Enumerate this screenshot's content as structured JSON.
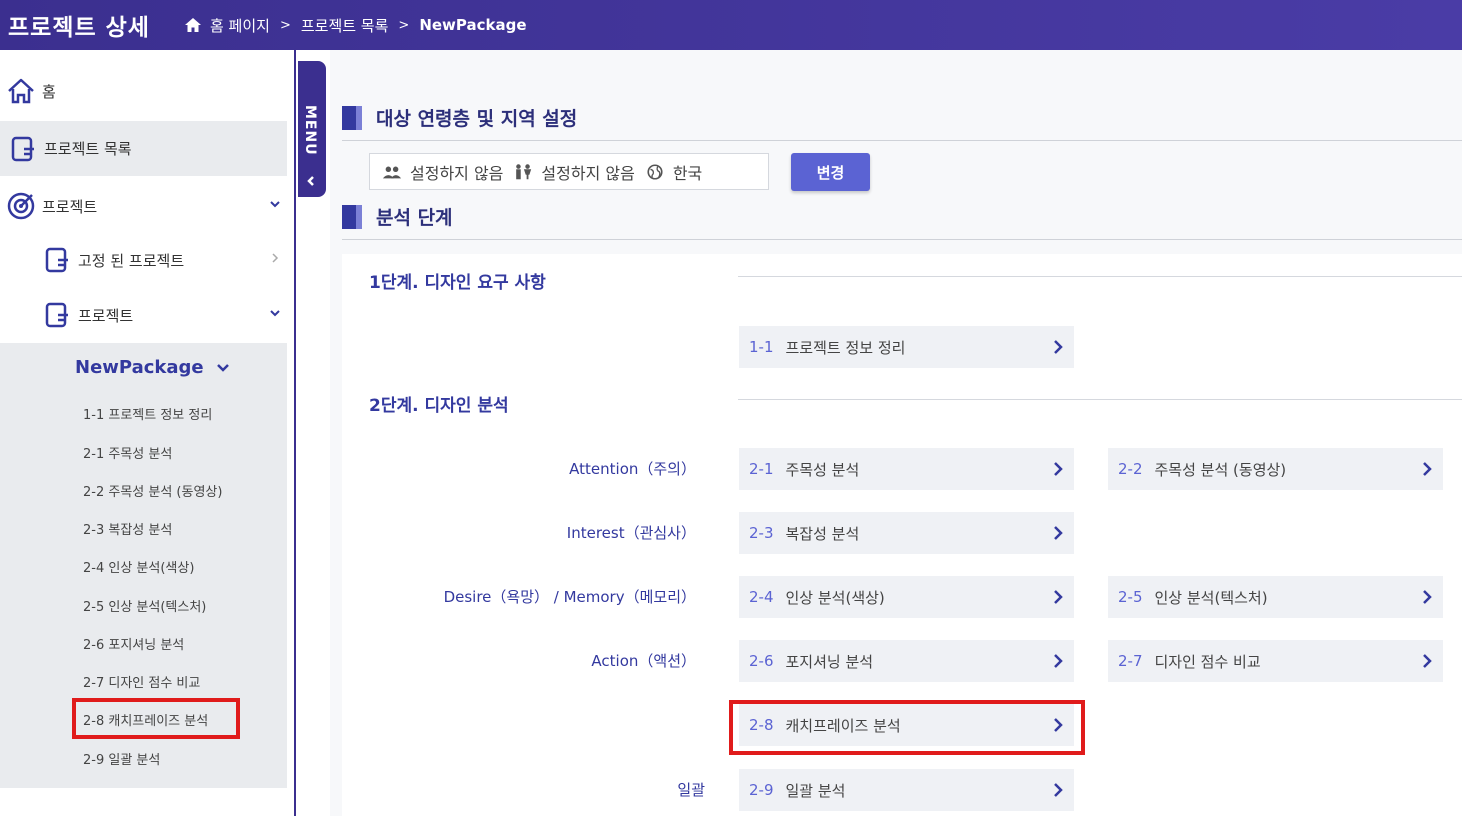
{
  "header": {
    "title": "프로젝트 상세",
    "breadcrumb": [
      "홈 페이지",
      "프로젝트 목록",
      "NewPackage"
    ],
    "separator": ">"
  },
  "sidebar": {
    "home": "홈",
    "project_list": "프로젝트 목록",
    "project": "프로젝트",
    "fixed_project": "고정 된 프로젝트",
    "project_sub": "프로젝트",
    "package": {
      "name": "NewPackage",
      "items": [
        "1-1 프로젝트 정보 정리",
        "2-1 주목성 분석",
        "2-2 주목성 분석 (동영상)",
        "2-3 복잡성 분석",
        "2-4 인상 분석(색상)",
        "2-5 인상 분석(텍스처)",
        "2-6 포지셔닝 분석",
        "2-7 디자인 점수 비교",
        "2-8 캐치프레이즈 분석",
        "2-9 일괄 분석"
      ]
    }
  },
  "menu_tab": {
    "label": "MENU"
  },
  "section1": {
    "title": "대상 연령층 및 지역 설정",
    "age": "설정하지 않음",
    "gender": "설정하지 않음",
    "region": "한국",
    "change_button": "변경"
  },
  "section2": {
    "title": "분석 단계",
    "step1": {
      "title": "1단계. 디자인 요구 사항",
      "cards": [
        {
          "num": "1-1",
          "label": "프로젝트 정보 정리"
        }
      ]
    },
    "step2": {
      "title": "2단계. 디자인 분석",
      "rows": [
        {
          "label": "Attention（주의）",
          "cards": [
            {
              "num": "2-1",
              "label": "주목성 분석"
            },
            {
              "num": "2-2",
              "label": "주목성 분석 (동영상)"
            }
          ]
        },
        {
          "label": "Interest（관심사）",
          "cards": [
            {
              "num": "2-3",
              "label": "복잡성 분석"
            }
          ]
        },
        {
          "label": "Desire（욕망） / Memory（메모리）",
          "cards": [
            {
              "num": "2-4",
              "label": "인상 분석(색상)"
            },
            {
              "num": "2-5",
              "label": "인상 분석(텍스처)"
            }
          ]
        },
        {
          "label": "Action（액션）",
          "cards": [
            {
              "num": "2-6",
              "label": "포지셔닝 분석"
            },
            {
              "num": "2-7",
              "label": "디자인 점수 비교"
            }
          ]
        },
        {
          "label": "",
          "cards": [
            {
              "num": "2-8",
              "label": "캐치프레이즈 분석"
            }
          ]
        },
        {
          "label": "일괄",
          "cards": [
            {
              "num": "2-9",
              "label": "일괄 분석"
            }
          ]
        }
      ]
    }
  },
  "colors": {
    "header": "#3b2f8f",
    "accent": "#33399f",
    "button": "#5b63d3",
    "highlight": "#e01b1b"
  }
}
